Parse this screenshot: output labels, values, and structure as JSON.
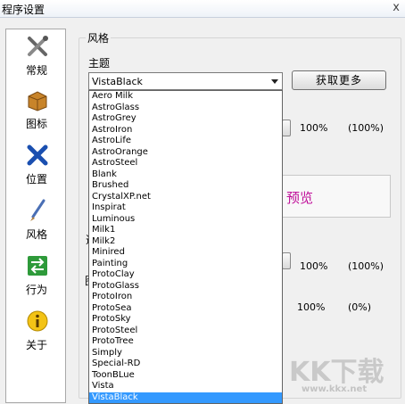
{
  "window": {
    "title": "程序设置",
    "close": "x"
  },
  "sidebar": {
    "items": [
      {
        "label": "常规",
        "icon": "tools-icon"
      },
      {
        "label": "图标",
        "icon": "box-icon"
      },
      {
        "label": "位置",
        "icon": "move-icon"
      },
      {
        "label": "风格",
        "icon": "brush-icon"
      },
      {
        "label": "行为",
        "icon": "arrows-icon"
      },
      {
        "label": "关于",
        "icon": "info-icon"
      }
    ]
  },
  "style": {
    "group_title": "风格",
    "theme_label": "主题",
    "theme_value": "VistaBlack",
    "get_more": "获取更多",
    "preview_text": "预览",
    "frag_a": "透",
    "frag_b": "图",
    "slider1": {
      "value": "100%",
      "right": "(100%)",
      "level": 100
    },
    "slider2": {
      "value": "100%",
      "right": "(100%)",
      "level": 100
    },
    "slider3": {
      "value": "100%",
      "right": "(0%)"
    }
  },
  "dropdown": {
    "items": [
      "Aero Milk",
      "AstroGlass",
      "AstroGrey",
      "AstroIron",
      "AstroLife",
      "AstroOrange",
      "AstroSteel",
      "Blank",
      "Brushed",
      "CrystalXP.net",
      "Inspirat",
      "Luminous",
      "Milk1",
      "Milk2",
      "Minired",
      "Painting",
      "ProtoClay",
      "ProtoGlass",
      "ProtoIron",
      "ProtoSea",
      "ProtoSky",
      "ProtoSteel",
      "ProtoTree",
      "Simply",
      "Special-RD",
      "ToonBLue",
      "Vista",
      "VistaBlack"
    ],
    "selected": "VistaBlack"
  },
  "watermark": {
    "logo": "KK下载",
    "url": "www.kkx.net"
  },
  "colors": {
    "selection": "#3399ff",
    "preview_text": "#c0109a"
  }
}
